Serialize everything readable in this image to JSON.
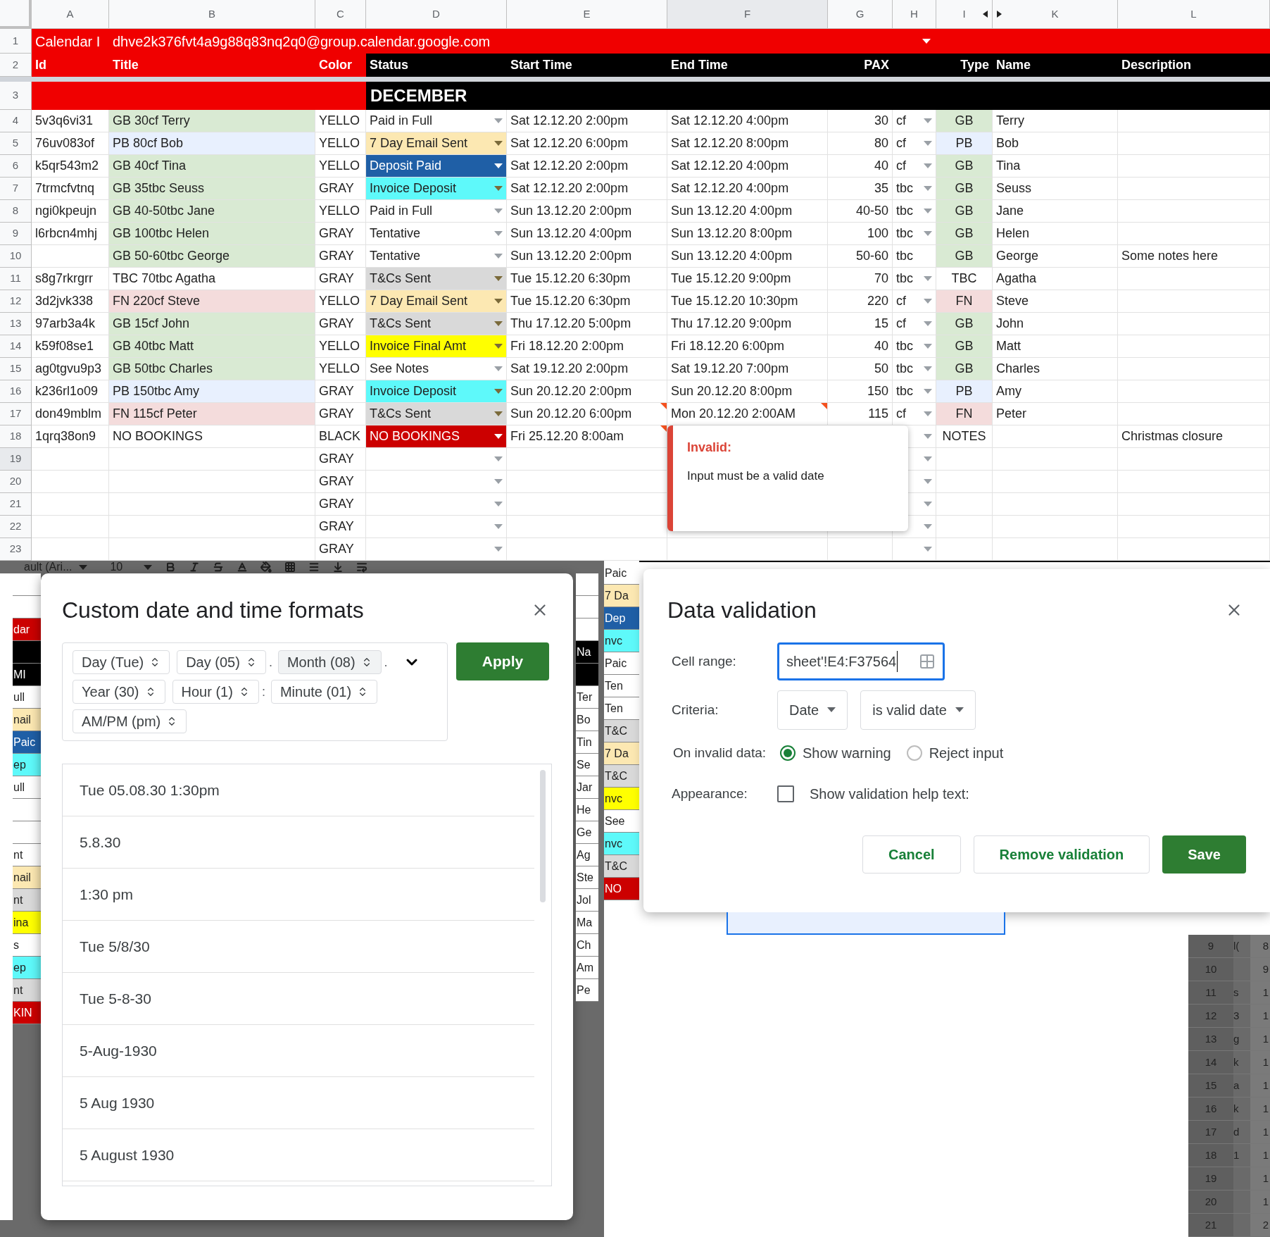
{
  "sheet": {
    "columns": [
      {
        "label": "A",
        "selected": false
      },
      {
        "label": "B",
        "selected": false
      },
      {
        "label": "C",
        "selected": false
      },
      {
        "label": "D",
        "selected": false
      },
      {
        "label": "E",
        "selected": false
      },
      {
        "label": "F",
        "selected": true
      },
      {
        "label": "G",
        "selected": false
      },
      {
        "label": "H",
        "selected": false
      },
      {
        "label": "I",
        "selected": false
      },
      {
        "label": "K",
        "selected": false
      },
      {
        "label": "L",
        "selected": false
      }
    ],
    "title_row": {
      "number": "1",
      "label": "Calendar I",
      "value": "dhve2k376fvt4a9g88q83nq2q0@group.calendar.google.com"
    },
    "header_row": {
      "number": "2",
      "cells": [
        "Id",
        "Title",
        "Color",
        "Status",
        "Start Time",
        "End Time",
        "PAX",
        "Type",
        "Name",
        "Description"
      ]
    },
    "month_row": {
      "number": "3",
      "label": "DECEMBER"
    },
    "rows": [
      {
        "number": "4",
        "selected": false,
        "id": "5v3q6vi31",
        "title": {
          "text": "GB 30cf Terry",
          "color": "#d9ead3"
        },
        "color_name": "YELLO",
        "status": {
          "text": "Paid in Full",
          "color": "#ffffff"
        },
        "start": "Sat 12.12.20 2:00pm",
        "end": "Sat 12.12.20 4:00pm",
        "pax": "30",
        "unit": "cf",
        "unit_dropdown": true,
        "type": {
          "text": "GB",
          "color": "#d9ead3"
        },
        "name": "Terry"
      },
      {
        "number": "5",
        "selected": false,
        "id": "76uv083of",
        "title": {
          "text": "PB 80cf Bob",
          "color": "#e8f0fe"
        },
        "color_name": "YELLO",
        "status": {
          "text": "7 Day Email Sent",
          "color": "#fce8b2"
        },
        "start": "Sat 12.12.20 6:00pm",
        "end": "Sat 12.12.20 8:00pm",
        "pax": "80",
        "unit": "cf",
        "unit_dropdown": true,
        "type": {
          "text": "PB",
          "color": "#e8f0fe"
        },
        "name": "Bob"
      },
      {
        "number": "6",
        "selected": false,
        "id": "k5qr543m2",
        "title": {
          "text": "GB 40cf Tina",
          "color": "#d9ead3"
        },
        "color_name": "YELLO",
        "status": {
          "text": "Deposit Paid",
          "color": "#1f5fa6"
        },
        "start": "Sat 12.12.20 2:00pm",
        "end": "Sat 12.12.20 4:00pm",
        "pax": "40",
        "unit": "cf",
        "unit_dropdown": true,
        "type": {
          "text": "GB",
          "color": "#d9ead3"
        },
        "name": "Tina"
      },
      {
        "number": "7",
        "selected": false,
        "id": "7trmcfvtnq",
        "title": {
          "text": "GB 35tbc Seuss",
          "color": "#d9ead3"
        },
        "color_name": "GRAY",
        "status": {
          "text": "Invoice Deposit",
          "color": "#5ef9fa"
        },
        "start": "Sat 12.12.20 2:00pm",
        "end": "Sat 12.12.20 4:00pm",
        "pax": "35",
        "unit": "tbc",
        "unit_dropdown": true,
        "type": {
          "text": "GB",
          "color": "#d9ead3"
        },
        "name": "Seuss"
      },
      {
        "number": "8",
        "selected": false,
        "id": "ngi0kpeujn",
        "title": {
          "text": "GB 40-50tbc Jane",
          "color": "#d9ead3"
        },
        "color_name": "YELLO",
        "status": {
          "text": "Paid in Full",
          "color": "#ffffff"
        },
        "start": "Sun 13.12.20 2:00pm",
        "end": "Sun 13.12.20 4:00pm",
        "pax": "40-50",
        "unit": "tbc",
        "unit_dropdown": true,
        "type": {
          "text": "GB",
          "color": "#d9ead3"
        },
        "name": "Jane"
      },
      {
        "number": "9",
        "selected": false,
        "id": "l6rbcn4mhj",
        "title": {
          "text": "GB 100tbc Helen",
          "color": "#d9ead3"
        },
        "color_name": "GRAY",
        "status": {
          "text": "Tentative",
          "color": "#ffffff"
        },
        "start": "Sun 13.12.20 4:00pm",
        "end": "Sun 13.12.20 8:00pm",
        "pax": "100",
        "unit": "tbc",
        "unit_dropdown": true,
        "type": {
          "text": "GB",
          "color": "#d9ead3"
        },
        "name": "Helen"
      },
      {
        "number": "10",
        "selected": false,
        "title": {
          "text": "GB 50-60tbc George",
          "color": "#d9ead3"
        },
        "color_name": "GRAY",
        "status": {
          "text": "Tentative",
          "color": "#ffffff"
        },
        "start": "Sun 13.12.20 2:00pm",
        "end": "Sun 13.12.20 4:00pm",
        "pax": "50-60",
        "unit": "tbc",
        "unit_dropdown": false,
        "type": {
          "text": "GB",
          "color": "#d9ead3"
        },
        "name": "George",
        "description": "Some notes here"
      },
      {
        "number": "11",
        "selected": false,
        "id": "s8g7rkrgrr",
        "title": {
          "text": "TBC 70tbc Agatha",
          "color": "#ffffff"
        },
        "color_name": "GRAY",
        "status": {
          "text": "T&Cs Sent",
          "color": "#d9d9d9"
        },
        "start": "Tue 15.12.20 6:30pm",
        "end": "Tue 15.12.20 9:00pm",
        "pax": "70",
        "unit": "tbc",
        "unit_dropdown": true,
        "type": {
          "text": "TBC",
          "color": "#ffffff"
        },
        "name": "Agatha"
      },
      {
        "number": "12",
        "selected": false,
        "id": "3d2jvk338",
        "title": {
          "text": "FN 220cf Steve",
          "color": "#f4dcdc"
        },
        "color_name": "YELLO",
        "status": {
          "text": "7 Day Email Sent",
          "color": "#fce8b2"
        },
        "start": "Tue 15.12.20 6:30pm",
        "end": "Tue 15.12.20 10:30pm",
        "pax": "220",
        "unit": "cf",
        "unit_dropdown": true,
        "type": {
          "text": "FN",
          "color": "#f4dcdc"
        },
        "name": "Steve"
      },
      {
        "number": "13",
        "selected": false,
        "id": "97arb3a4k",
        "title": {
          "text": "GB 15cf John",
          "color": "#d9ead3"
        },
        "color_name": "GRAY",
        "status": {
          "text": "T&Cs Sent",
          "color": "#d9d9d9"
        },
        "start": "Thu 17.12.20 5:00pm",
        "end": "Thu 17.12.20 9:00pm",
        "pax": "15",
        "unit": "cf",
        "unit_dropdown": true,
        "type": {
          "text": "GB",
          "color": "#d9ead3"
        },
        "name": "John"
      },
      {
        "number": "14",
        "selected": false,
        "id": "k59f08se1",
        "title": {
          "text": "GB 40tbc Matt",
          "color": "#d9ead3"
        },
        "color_name": "YELLO",
        "status": {
          "text": "Invoice Final Amt",
          "color": "#ffff00"
        },
        "start": "Fri 18.12.20 2:00pm",
        "end": "Fri 18.12.20 6:00pm",
        "pax": "40",
        "unit": "tbc",
        "unit_dropdown": true,
        "type": {
          "text": "GB",
          "color": "#d9ead3"
        },
        "name": "Matt"
      },
      {
        "number": "15",
        "selected": false,
        "id": "ag0tgvu9p3",
        "title": {
          "text": "GB 50tbc Charles",
          "color": "#d9ead3"
        },
        "color_name": "YELLO",
        "status": {
          "text": "See Notes",
          "color": "#ffffff"
        },
        "start": "Sat 19.12.20 2:00pm",
        "end": "Sat 19.12.20 7:00pm",
        "pax": "50",
        "unit": "tbc",
        "unit_dropdown": true,
        "type": {
          "text": "GB",
          "color": "#d9ead3"
        },
        "name": "Charles"
      },
      {
        "number": "16",
        "selected": false,
        "id": "k236rl1o09",
        "title": {
          "text": "PB 150tbc Amy",
          "color": "#e8f0fe"
        },
        "color_name": "GRAY",
        "status": {
          "text": "Invoice Deposit",
          "color": "#5ef9fa"
        },
        "start": "Sun 20.12.20 2:00pm",
        "end": "Sun 20.12.20 8:00pm",
        "pax": "150",
        "unit": "tbc",
        "unit_dropdown": true,
        "type": {
          "text": "PB",
          "color": "#e8f0fe"
        },
        "name": "Amy"
      },
      {
        "number": "17",
        "selected": false,
        "id": "don49mblm",
        "title": {
          "text": "FN 115cf Peter",
          "color": "#f4dcdc"
        },
        "color_name": "GRAY",
        "status": {
          "text": "T&Cs Sent",
          "color": "#d9d9d9"
        },
        "start": "Sun 20.12.20 6:00pm",
        "start_invalid": true,
        "end": "Mon 20.12.20 2:00AM",
        "end_invalid": true,
        "pax": "115",
        "unit": "cf",
        "unit_dropdown": true,
        "type": {
          "text": "FN",
          "color": "#f4dcdc"
        },
        "name": "Peter"
      },
      {
        "number": "18",
        "selected": false,
        "id": "1qrq38on9",
        "title": {
          "text": "NO BOOKINGS",
          "color": "#ffffff"
        },
        "color_name": "BLACK",
        "status": {
          "text": "NO BOOKINGS",
          "color": "#cc0000"
        },
        "start": "Fri 25.12.20 8:00am",
        "start_invalid": true,
        "unit_dropdown": true,
        "type": {
          "text": "NOTES",
          "color": "#ffffff"
        },
        "description": "Christmas closure"
      },
      {
        "number": "19",
        "selected": true,
        "color_name": "GRAY",
        "status": {
          "color": "#ffffff"
        },
        "unit_dropdown": true
      },
      {
        "number": "20",
        "selected": false,
        "color_name": "GRAY",
        "status": {
          "color": "#ffffff"
        },
        "unit_dropdown": true
      },
      {
        "number": "21",
        "selected": false,
        "color_name": "GRAY",
        "status": {
          "color": "#ffffff"
        },
        "unit_dropdown": true
      },
      {
        "number": "22",
        "selected": false,
        "color_name": "GRAY",
        "status": {
          "color": "#ffffff"
        },
        "unit_dropdown": true
      },
      {
        "number": "23",
        "selected": false,
        "color_name": "GRAY",
        "status": {
          "color": "#ffffff"
        },
        "unit_dropdown": true
      }
    ],
    "error_tooltip": {
      "title": "Invalid:",
      "message": "Input must be a valid date"
    }
  },
  "toolbar": {
    "font": "ault (Ari...",
    "size": "10"
  },
  "left_fragments": [
    {
      "color": "#ffffff"
    },
    {
      "color": "#ffffff"
    },
    {
      "text": "dar",
      "color": "#cc0000"
    },
    {
      "color": "#000000"
    },
    {
      "text": "MI",
      "color": "#000000"
    },
    {
      "text": "ull",
      "color": "#ffffff"
    },
    {
      "text": "nail",
      "color": "#fce8b2"
    },
    {
      "text": "Paic",
      "color": "#1f5fa6"
    },
    {
      "text": "ep",
      "color": "#5ef9fa"
    },
    {
      "text": "ull",
      "color": "#ffffff"
    },
    {
      "color": "#ffffff"
    },
    {
      "color": "#ffffff"
    },
    {
      "text": "nt",
      "color": "#ffffff"
    },
    {
      "text": "nail",
      "color": "#fce8b2"
    },
    {
      "text": "nt",
      "color": "#d9d9d9"
    },
    {
      "text": "ina",
      "color": "#ffff00"
    },
    {
      "text": "s",
      "color": "#ffffff"
    },
    {
      "text": "ep",
      "color": "#5ef9fa"
    },
    {
      "text": "nt",
      "color": "#d9d9d9"
    },
    {
      "text": "KIN",
      "color": "#cc0000"
    }
  ],
  "right_fragments": [
    {
      "color": "#ffffff"
    },
    {
      "color": "#ffffff"
    },
    {
      "color": "#ffffff"
    },
    {
      "text": "Na",
      "color": "#000000"
    },
    {
      "color": "#000000"
    },
    {
      "text": "Ter",
      "color": "#ffffff"
    },
    {
      "text": "Bo",
      "color": "#ffffff"
    },
    {
      "text": "Tin",
      "color": "#ffffff"
    },
    {
      "text": "Se",
      "color": "#ffffff"
    },
    {
      "text": "Jar",
      "color": "#ffffff"
    },
    {
      "text": "He",
      "color": "#ffffff"
    },
    {
      "text": "Ge",
      "color": "#ffffff"
    },
    {
      "text": "Ag",
      "color": "#ffffff"
    },
    {
      "text": "Ste",
      "color": "#ffffff"
    },
    {
      "text": "Jol",
      "color": "#ffffff"
    },
    {
      "text": "Ma",
      "color": "#ffffff"
    },
    {
      "text": "Ch",
      "color": "#ffffff"
    },
    {
      "text": "Am",
      "color": "#ffffff"
    },
    {
      "text": "Pe",
      "color": "#ffffff"
    }
  ],
  "middle_fragments": [
    {
      "text": "Paic",
      "color": "#ffffff"
    },
    {
      "text": "7 Da",
      "color": "#fce8b2"
    },
    {
      "text": "Dep",
      "color": "#1f5fa6"
    },
    {
      "text": "nvc",
      "color": "#5ef9fa"
    },
    {
      "text": "Paic",
      "color": "#ffffff"
    },
    {
      "text": "Ten",
      "color": "#ffffff"
    },
    {
      "text": "Ten",
      "color": "#ffffff"
    },
    {
      "text": "T&C",
      "color": "#d9d9d9"
    },
    {
      "text": "7 Da",
      "color": "#fce8b2"
    },
    {
      "text": "T&C",
      "color": "#d9d9d9"
    },
    {
      "text": "nvc",
      "color": "#ffff00"
    },
    {
      "text": "See",
      "color": "#ffffff"
    },
    {
      "text": "nvc",
      "color": "#5ef9fa"
    },
    {
      "text": "T&C",
      "color": "#d9d9d9"
    },
    {
      "text": "NO",
      "color": "#cc0000"
    }
  ],
  "format_dialog": {
    "title": "Custom date and time formats",
    "parts": [
      {
        "label": "Day (Tue)",
        "selected": false
      },
      {
        "label": "Day (05)",
        "selected": false,
        "separator": "."
      },
      {
        "label": "Month (08)",
        "selected": true,
        "separator": "."
      },
      {
        "label": "Year (30)",
        "selected": false
      },
      {
        "label": "Hour (1)",
        "selected": false,
        "separator": ":"
      },
      {
        "label": "Minute (01)",
        "selected": false
      },
      {
        "label": "AM/PM (pm)",
        "selected": false
      }
    ],
    "apply": "Apply",
    "formats": [
      "Tue 05.08.30 1:30pm",
      "5.8.30",
      "1:30 pm",
      "Tue 5/8/30",
      "Tue 5-8-30",
      "5-Aug-1930",
      "5 Aug 1930",
      "5 August 1930"
    ]
  },
  "validation_dialog": {
    "title": "Data validation",
    "cell_range_label": "Cell range:",
    "cell_range": "sheet'!E4:F37564",
    "criteria_label": "Criteria:",
    "criteria": [
      "Date",
      "is valid date"
    ],
    "invalid_label": "On invalid data:",
    "invalid_options": [
      {
        "label": "Show warning",
        "selected": true
      },
      {
        "label": "Reject input",
        "selected": false
      }
    ],
    "appearance_label": "Appearance:",
    "help_text": {
      "label": "Show validation help text:",
      "checked": false
    },
    "buttons": [
      {
        "label": "Cancel",
        "kind": "outline"
      },
      {
        "label": "Remove validation",
        "kind": "outline"
      },
      {
        "label": "Save",
        "kind": "primary"
      }
    ]
  },
  "background_rows": [
    {
      "number": "9",
      "col_a": "l(",
      "col_b": "8"
    },
    {
      "number": "10",
      "col_b": "9"
    },
    {
      "number": "11",
      "col_a": "s",
      "col_b": "1"
    },
    {
      "number": "12",
      "col_a": "3",
      "col_b": "1"
    },
    {
      "number": "13",
      "col_a": "g",
      "col_b": "1"
    },
    {
      "number": "14",
      "col_a": "k",
      "col_b": "1"
    },
    {
      "number": "15",
      "col_a": "a",
      "col_b": "1"
    },
    {
      "number": "16",
      "col_a": "k",
      "col_b": "1"
    },
    {
      "number": "17",
      "col_a": "d",
      "col_b": "1"
    },
    {
      "number": "18",
      "col_a": "1",
      "col_b": "1"
    },
    {
      "number": "19",
      "col_b": "1"
    },
    {
      "number": "20",
      "col_b": "1"
    },
    {
      "number": "21",
      "col_b": "2"
    }
  ]
}
